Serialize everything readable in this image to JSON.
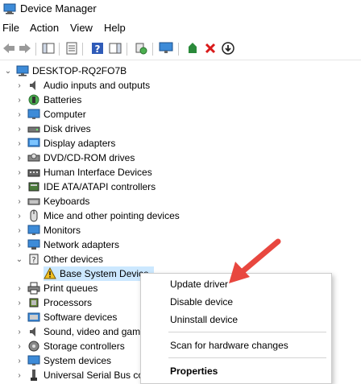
{
  "window": {
    "title": "Device Manager"
  },
  "menu": [
    "File",
    "Action",
    "View",
    "Help"
  ],
  "tree": {
    "root": "DESKTOP-RQ2FO7B",
    "categories": [
      {
        "label": "Audio inputs and outputs",
        "icon": "speaker-icon"
      },
      {
        "label": "Batteries",
        "icon": "battery-icon"
      },
      {
        "label": "Computer",
        "icon": "monitor-icon"
      },
      {
        "label": "Disk drives",
        "icon": "disk-icon"
      },
      {
        "label": "Display adapters",
        "icon": "display-adapter-icon"
      },
      {
        "label": "DVD/CD-ROM drives",
        "icon": "dvd-icon"
      },
      {
        "label": "Human Interface Devices",
        "icon": "hid-icon"
      },
      {
        "label": "IDE ATA/ATAPI controllers",
        "icon": "ide-controller-icon"
      },
      {
        "label": "Keyboards",
        "icon": "keyboard-icon"
      },
      {
        "label": "Mice and other pointing devices",
        "icon": "mouse-icon"
      },
      {
        "label": "Monitors",
        "icon": "monitor-icon"
      },
      {
        "label": "Network adapters",
        "icon": "network-icon"
      },
      {
        "label": "Other devices",
        "icon": "unknown-device-icon"
      },
      {
        "label": "Base System Device",
        "icon": "warning-device-icon"
      },
      {
        "label": "Print queues",
        "icon": "printer-icon"
      },
      {
        "label": "Processors",
        "icon": "processor-icon"
      },
      {
        "label": "Software devices",
        "icon": "software-device-icon"
      },
      {
        "label": "Sound, video and gam",
        "icon": "sound-icon"
      },
      {
        "label": "Storage controllers",
        "icon": "storage-icon"
      },
      {
        "label": "System devices",
        "icon": "system-icon"
      },
      {
        "label": "Universal Serial Bus co",
        "icon": "usb-icon"
      }
    ]
  },
  "context_menu": {
    "update": "Update driver",
    "disable": "Disable device",
    "uninstall": "Uninstall device",
    "scan": "Scan for hardware changes",
    "properties": "Properties"
  },
  "colors": {
    "arrow": "#e8473f",
    "toolbar_uninstall": "#d91a1a",
    "toolbar_update": "#2a8a3a"
  }
}
